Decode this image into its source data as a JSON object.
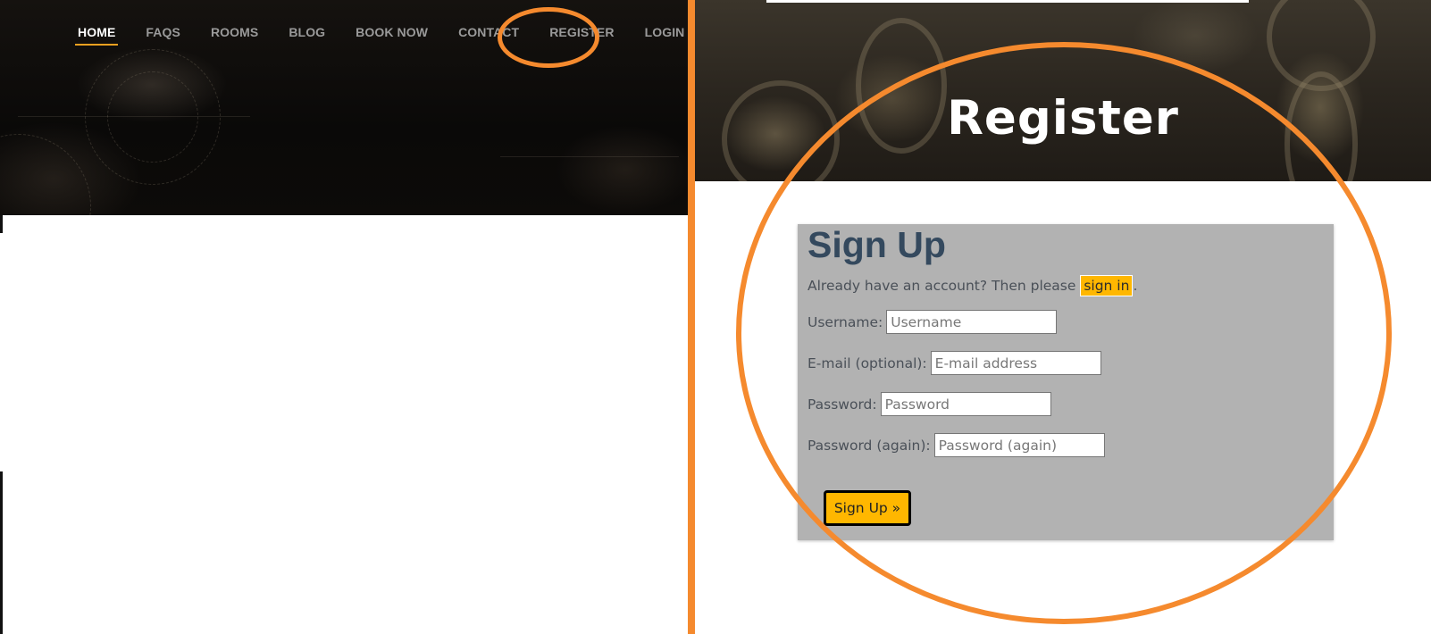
{
  "nav": {
    "items": [
      {
        "label": "HOME",
        "active": true
      },
      {
        "label": "FAQS",
        "active": false
      },
      {
        "label": "ROOMS",
        "active": false
      },
      {
        "label": "BLOG",
        "active": false
      },
      {
        "label": "BOOK NOW",
        "active": false
      },
      {
        "label": "CONTACT",
        "active": false
      },
      {
        "label": "REGISTER",
        "active": false
      },
      {
        "label": "LOGIN",
        "active": false
      }
    ]
  },
  "register_page": {
    "title": "Register",
    "form": {
      "heading": "Sign Up",
      "already_text": "Already have an account? Then please ",
      "signin_label": "sign in",
      "already_suffix": ".",
      "fields": [
        {
          "label": "Username:",
          "placeholder": "Username",
          "value": ""
        },
        {
          "label": "E-mail (optional):",
          "placeholder": "E-mail address",
          "value": ""
        },
        {
          "label": "Password:",
          "placeholder": "Password",
          "value": ""
        },
        {
          "label": "Password (again):",
          "placeholder": "Password (again)",
          "value": ""
        }
      ],
      "submit_label": "Sign Up »"
    }
  },
  "colors": {
    "accent": "#ffb700",
    "annotation": "#f58a2e",
    "card_bg": "#b2b2b2",
    "heading": "#34495e",
    "nav_active_underline": "#f0a020"
  }
}
